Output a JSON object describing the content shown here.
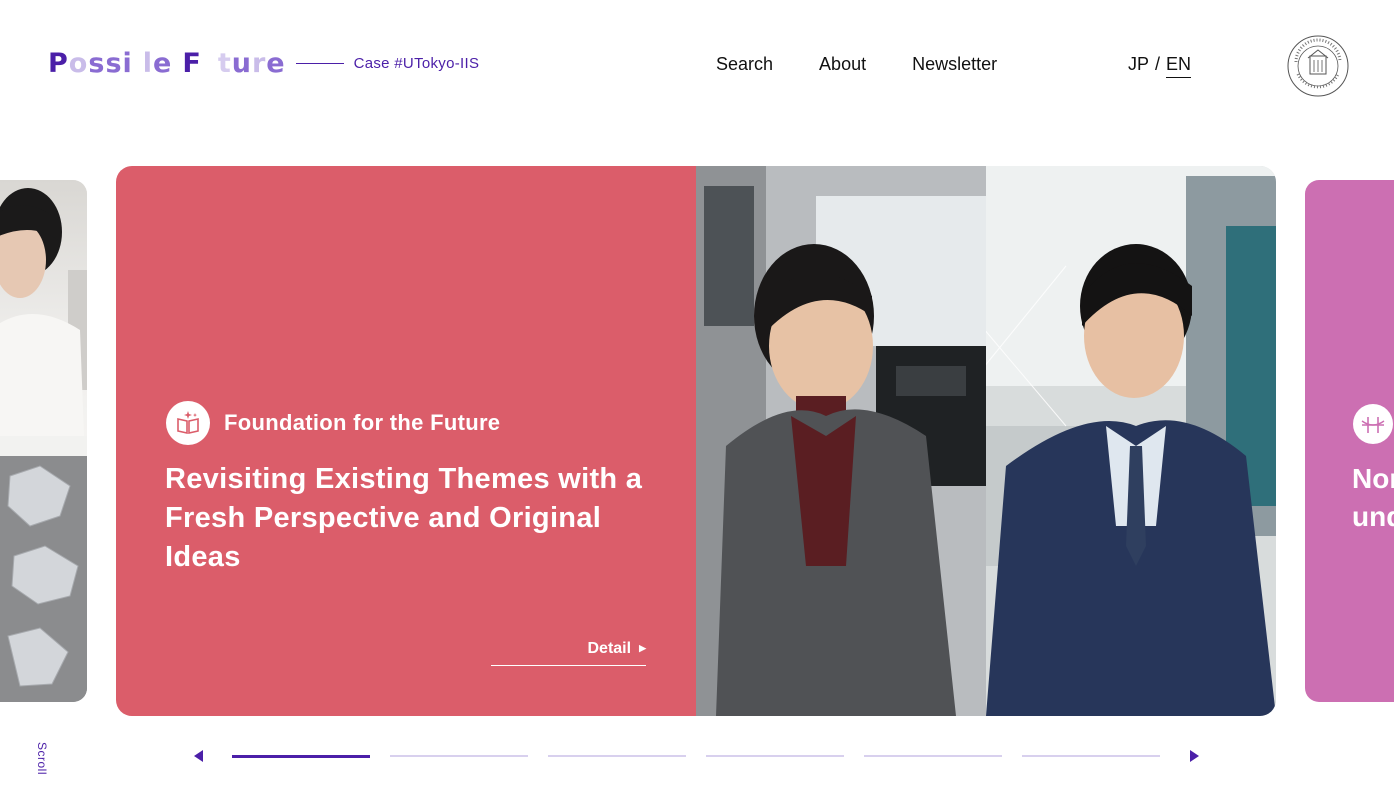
{
  "header": {
    "logo_letters": [
      "P",
      "o",
      "s",
      "s",
      "i",
      " ",
      "l",
      "e",
      " ",
      "F",
      " ",
      "t",
      "u",
      "r",
      "e"
    ],
    "case_label": "Case #UTokyo-IIS",
    "nav": [
      "Search",
      "About",
      "Newsletter"
    ],
    "lang_jp": "JP",
    "lang_sep": "/",
    "lang_en": "EN",
    "seal_icon": "university-seal-icon"
  },
  "slider": {
    "current": {
      "category": "Foundation for the Future",
      "category_icon": "book-sparkle-icon",
      "title": "Revisiting Existing Themes with a Fresh Perspective and Original Ideas",
      "detail_label": "Detail"
    },
    "next_peek": {
      "title_line1": "Nor",
      "title_line2": "und",
      "category_icon": "bridge-icon"
    },
    "active_index": 1,
    "total": 6
  },
  "scroll_label": "Scroll",
  "colors": {
    "accent": "#4b1fa8",
    "card_red": "#db5d6a",
    "card_pink": "#cc6fb2"
  }
}
